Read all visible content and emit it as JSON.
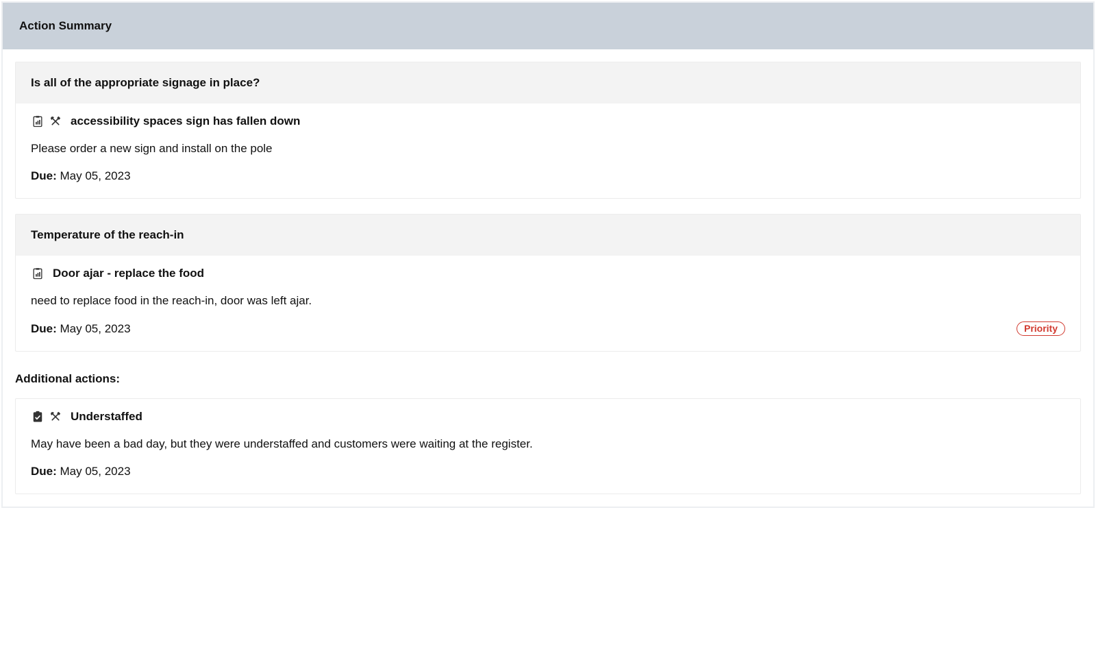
{
  "header": {
    "title": "Action Summary"
  },
  "sections": [
    {
      "question": "Is all of the appropriate signage in place?",
      "icons": [
        "clipboard-chart-icon",
        "tools-icon"
      ],
      "item_title": "accessibility spaces sign has fallen down",
      "item_desc": "Please order a new sign and install on the pole",
      "due_label": "Due:",
      "due_value": "May 05, 2023",
      "priority": false
    },
    {
      "question": "Temperature of the reach-in",
      "icons": [
        "clipboard-chart-icon"
      ],
      "item_title": "Door ajar - replace the food",
      "item_desc": "need to replace food in the reach-in, door was left ajar.",
      "due_label": "Due:",
      "due_value": "May 05, 2023",
      "priority": true,
      "priority_label": "Priority"
    }
  ],
  "additional_label": "Additional actions:",
  "additional": [
    {
      "icons": [
        "clipboard-check-filled-icon",
        "tools-icon"
      ],
      "item_title": "Understaffed",
      "item_desc": "May have been a bad day, but they were understaffed and customers were waiting at the register.",
      "due_label": "Due:",
      "due_value": "May 05, 2023"
    }
  ]
}
